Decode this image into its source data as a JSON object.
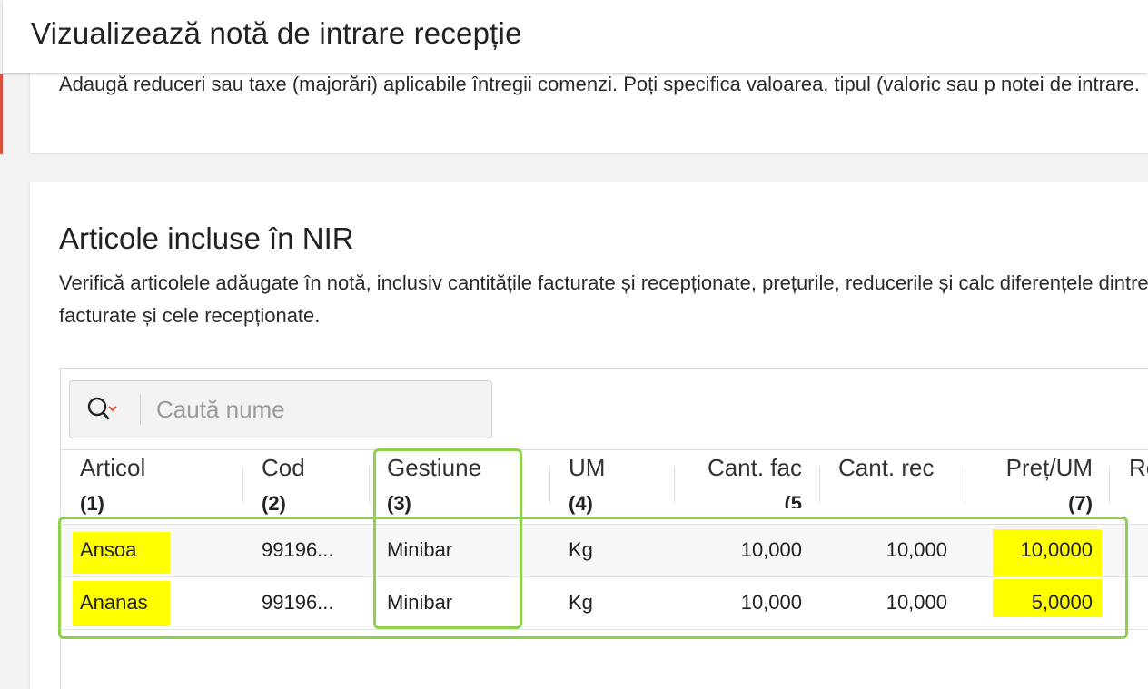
{
  "header": {
    "title": "Vizualizează notă de intrare recepție"
  },
  "discounts_card": {
    "description": "Adaugă reduceri sau taxe (majorări) aplicabile întregii comenzi. Poți specifica valoarea, tipul (valoric sau p notei de intrare."
  },
  "items_card": {
    "title": "Articole incluse în NIR",
    "description": "Verifică articolele adăugate în notă, inclusiv cantitățile facturate și recepționate, prețurile, reducerile și calc diferențele dintre valorile facturate și cele recepționate."
  },
  "search": {
    "placeholder": "Caută nume"
  },
  "table": {
    "columns": [
      {
        "label": "Articol",
        "index": "(1)"
      },
      {
        "label": "Cod",
        "index": "(2)"
      },
      {
        "label": "Gestiune",
        "index": "(3)"
      },
      {
        "label": "UM",
        "index": "(4)"
      },
      {
        "label": "Cant. fac",
        "index": "(5"
      },
      {
        "label": "Cant. rec",
        "index": ""
      },
      {
        "label": "Preț/UM",
        "index": "(7)"
      },
      {
        "label": "Re",
        "index": ""
      }
    ],
    "rows": [
      {
        "articol": "Ansoa",
        "cod": "99196...",
        "gestiune": "Minibar",
        "um": "Kg",
        "cant_fac": "10,000",
        "cant_rec": "10,000",
        "pret_um": "10,0000"
      },
      {
        "articol": "Ananas",
        "cod": "99196...",
        "gestiune": "Minibar",
        "um": "Kg",
        "cant_fac": "10,000",
        "cant_rec": "10,000",
        "pret_um": "5,0000"
      }
    ]
  },
  "colors": {
    "highlight": "#ffff00",
    "annotation_outline": "#8fd14f",
    "search_chevron": "#e0532f"
  }
}
